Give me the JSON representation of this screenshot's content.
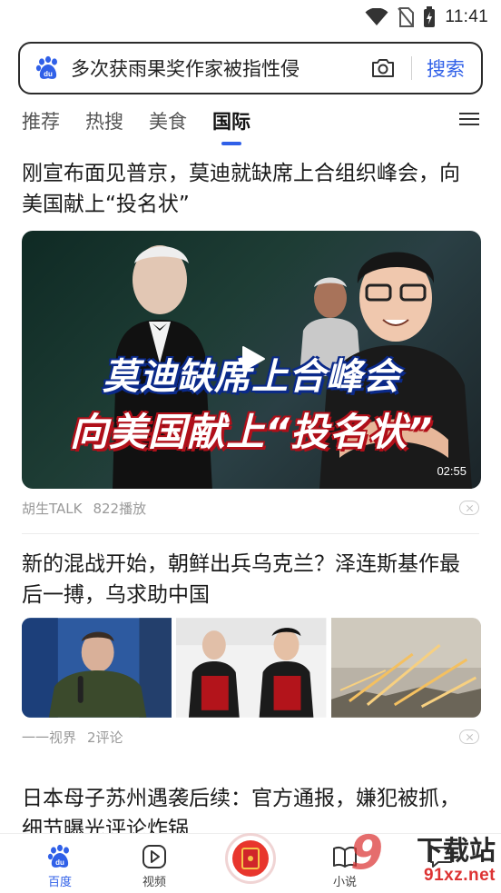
{
  "status_bar": {
    "time": "11:41",
    "icons": [
      "wifi-icon",
      "no-sim-icon",
      "battery-charging-icon"
    ]
  },
  "search": {
    "query": "多次获雨果奖作家被指性侵",
    "button_label": "搜索",
    "icons": [
      "baidu-paw-icon",
      "camera-icon"
    ]
  },
  "tabs": {
    "items": [
      {
        "label": "推荐",
        "active": false
      },
      {
        "label": "热搜",
        "active": false
      },
      {
        "label": "美食",
        "active": false
      },
      {
        "label": "国际",
        "active": true
      }
    ],
    "menu_icon": "menu-icon"
  },
  "feed": {
    "items": [
      {
        "title": "刚宣布面见普京，莫迪就缺席上合组织峰会，向美国献上“投名状”",
        "video": {
          "caption_line1": "莫迪缺席上合峰会",
          "caption_line2": "向美国献上“投名状”",
          "duration": "02:55"
        },
        "source": "胡生TALK",
        "stat": "822播放"
      },
      {
        "title": "新的混战开始，朝鲜出兵乌克兰？泽连斯基作最后一搏，乌求助中国",
        "thumbnail_count": 3,
        "source": "一一视界",
        "stat": "2评论"
      },
      {
        "title": "日本母子苏州遇袭后续：官方通报，嫌犯被抓，细节曝光评论炸锅"
      }
    ]
  },
  "bottom_nav": {
    "items": [
      {
        "label": "百度",
        "icon": "baidu-paw-icon",
        "active": true
      },
      {
        "label": "视频",
        "icon": "video-play-icon",
        "active": false
      },
      {
        "label": "",
        "icon": "red-packet-icon",
        "active": false
      },
      {
        "label": "小说",
        "icon": "book-icon",
        "active": false
      },
      {
        "label": "",
        "icon": "message-icon",
        "active": false
      }
    ]
  },
  "watermark": {
    "logo_text": "9",
    "text_cn": "下载站",
    "url": "91xz.net"
  },
  "colors": {
    "accent": "#3060e8",
    "red": "#e8362d"
  }
}
